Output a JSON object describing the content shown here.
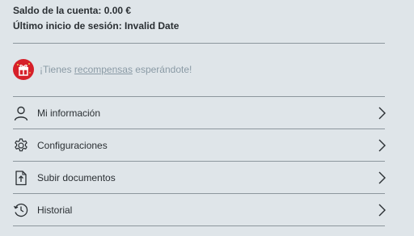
{
  "account": {
    "balance_line": "Saldo de la cuenta: 0.00 €",
    "last_login_line": "Último inicio de sesión: Invalid Date"
  },
  "rewards": {
    "prefix": "¡Tienes ",
    "link_text": "recompensas",
    "suffix": " esperándote!",
    "icon": "gift-icon",
    "badge_color": "#d6202a"
  },
  "menu": {
    "items": [
      {
        "label": "Mi información",
        "icon": "user-icon"
      },
      {
        "label": "Configuraciones",
        "icon": "gear-icon"
      },
      {
        "label": "Subir documentos",
        "icon": "upload-document-icon"
      },
      {
        "label": "Historial",
        "icon": "history-icon"
      }
    ]
  },
  "colors": {
    "background": "#dfe5e9",
    "text": "#2a2f33",
    "muted_text": "#8a9aa5",
    "divider": "#8d979d"
  }
}
